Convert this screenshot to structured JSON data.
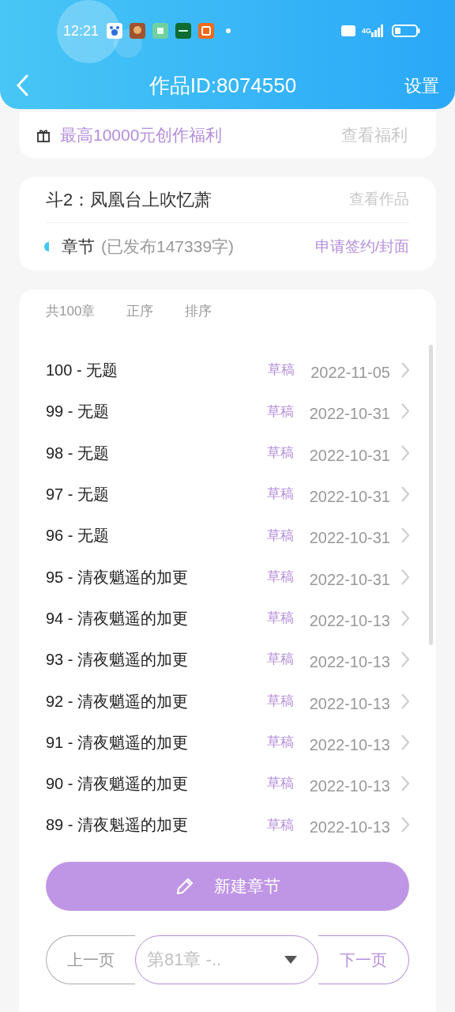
{
  "status_bar": {
    "time": "12:21",
    "network": "4G"
  },
  "header": {
    "title": "作品ID:8074550",
    "action": "设置"
  },
  "welfare": {
    "text": "最高10000元创作福利",
    "link": "查看福利"
  },
  "work": {
    "title": "斗2：凤凰台上吹忆萧",
    "link": "查看作品",
    "section": "章节",
    "stats": "(已发布147339字)",
    "action": "申请签约/封面"
  },
  "chapters": {
    "total": "共100章",
    "sort_options": [
      {
        "label": "正序",
        "selected": false
      },
      {
        "label": "排序",
        "selected": false
      }
    ],
    "rows": [
      {
        "title": "100 - 无题",
        "status": "草稿",
        "date": "2022-11-05"
      },
      {
        "title": "99 - 无题",
        "status": "草稿",
        "date": "2022-10-31"
      },
      {
        "title": "98 - 无题",
        "status": "草稿",
        "date": "2022-10-31"
      },
      {
        "title": "97 - 无题",
        "status": "草稿",
        "date": "2022-10-31"
      },
      {
        "title": "96 - 无题",
        "status": "草稿",
        "date": "2022-10-31"
      },
      {
        "title": "95 - 清夜魈遥的加更",
        "status": "草稿",
        "date": "2022-10-31"
      },
      {
        "title": "94 - 清夜魈遥的加更",
        "status": "草稿",
        "date": "2022-10-13"
      },
      {
        "title": "93 - 清夜魈遥的加更",
        "status": "草稿",
        "date": "2022-10-13"
      },
      {
        "title": "92 - 清夜魈遥的加更",
        "status": "草稿",
        "date": "2022-10-13"
      },
      {
        "title": "91 - 清夜魈遥的加更",
        "status": "草稿",
        "date": "2022-10-13"
      },
      {
        "title": "90 - 清夜魈遥的加更",
        "status": "草稿",
        "date": "2022-10-13"
      },
      {
        "title": "89 - 清夜魁遥的加更",
        "status": "草稿",
        "date": "2022-10-13"
      }
    ],
    "new_button": "新建章节",
    "pagination": {
      "prev": "上一页",
      "chapter_select": "第81章 -..",
      "next": "下一页"
    }
  }
}
